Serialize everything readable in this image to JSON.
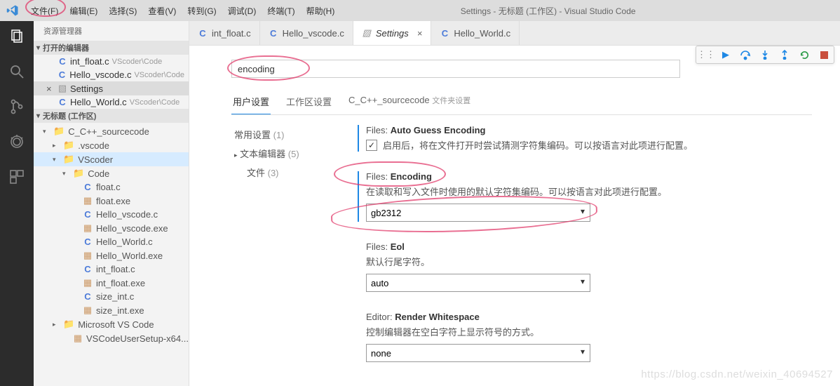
{
  "titlebar": {
    "menus": [
      "文件(F)",
      "编辑(E)",
      "选择(S)",
      "查看(V)",
      "转到(G)",
      "调试(D)",
      "终端(T)",
      "帮助(H)"
    ],
    "title": "Settings - 无标题 (工作区) - Visual Studio Code"
  },
  "sidebar": {
    "title": "资源管理器",
    "openEditorsHeader": "打开的编辑器",
    "openEditors": [
      {
        "icon": "C",
        "name": "int_float.c",
        "path": "VScoder\\Code",
        "active": false
      },
      {
        "icon": "C",
        "name": "Hello_vscode.c",
        "path": "VScoder\\Code",
        "active": false
      },
      {
        "icon": "S",
        "name": "Settings",
        "path": "",
        "active": true
      },
      {
        "icon": "C",
        "name": "Hello_World.c",
        "path": "VScoder\\Code",
        "active": false
      }
    ],
    "workspaceHeader": "无标题 (工作区)",
    "tree": [
      {
        "depth": 0,
        "chev": "▾",
        "type": "folder",
        "name": "C_C++_sourcecode"
      },
      {
        "depth": 1,
        "chev": "▸",
        "type": "folder-blue",
        "name": ".vscode"
      },
      {
        "depth": 1,
        "chev": "▾",
        "type": "folder",
        "name": "VScoder",
        "sel": true
      },
      {
        "depth": 2,
        "chev": "▾",
        "type": "folder",
        "name": "Code"
      },
      {
        "depth": 3,
        "chev": "",
        "type": "c",
        "name": "float.c"
      },
      {
        "depth": 3,
        "chev": "",
        "type": "exe",
        "name": "float.exe"
      },
      {
        "depth": 3,
        "chev": "",
        "type": "c",
        "name": "Hello_vscode.c"
      },
      {
        "depth": 3,
        "chev": "",
        "type": "exe",
        "name": "Hello_vscode.exe"
      },
      {
        "depth": 3,
        "chev": "",
        "type": "c",
        "name": "Hello_World.c"
      },
      {
        "depth": 3,
        "chev": "",
        "type": "exe",
        "name": "Hello_World.exe"
      },
      {
        "depth": 3,
        "chev": "",
        "type": "c",
        "name": "int_float.c"
      },
      {
        "depth": 3,
        "chev": "",
        "type": "exe",
        "name": "int_float.exe"
      },
      {
        "depth": 3,
        "chev": "",
        "type": "c",
        "name": "size_int.c"
      },
      {
        "depth": 3,
        "chev": "",
        "type": "exe",
        "name": "size_int.exe"
      },
      {
        "depth": 1,
        "chev": "▸",
        "type": "folder",
        "name": "Microsoft VS Code"
      },
      {
        "depth": 2,
        "chev": "",
        "type": "exe",
        "name": "VSCodeUserSetup-x64..."
      }
    ]
  },
  "tabs": [
    {
      "icon": "C",
      "label": "int_float.c",
      "active": false
    },
    {
      "icon": "C",
      "label": "Hello_vscode.c",
      "active": false
    },
    {
      "icon": "S",
      "label": "Settings",
      "active": true
    },
    {
      "icon": "C",
      "label": "Hello_World.c",
      "active": false
    }
  ],
  "settings": {
    "search_value": "encoding",
    "scopes": {
      "user": "用户设置",
      "workspace": "工作区设置",
      "folder": "C_C++_sourcecode",
      "folder_sub": "文件夹设置"
    },
    "nav": [
      {
        "label": "常用设置",
        "count": "(1)",
        "indent": 0
      },
      {
        "label": "文本编辑器",
        "count": "(5)",
        "indent": 0,
        "chev": "▸"
      },
      {
        "label": "文件",
        "count": "(3)",
        "indent": 1
      }
    ],
    "items": {
      "autoGuess": {
        "prefix": "Files:",
        "name": "Auto Guess Encoding",
        "desc": "启用后，将在文件打开时尝试猜测字符集编码。可以按语言对此项进行配置。",
        "checked": true
      },
      "encoding": {
        "prefix": "Files:",
        "name": "Encoding",
        "desc": "在读取和写入文件时使用的默认字符集编码。可以按语言对此项进行配置。",
        "value": "gb2312"
      },
      "eol": {
        "prefix": "Files:",
        "name": "Eol",
        "desc": "默认行尾字符。",
        "value": "auto"
      },
      "renderWs": {
        "prefix": "Editor:",
        "name": "Render Whitespace",
        "desc": "控制编辑器在空白字符上显示符号的方式。",
        "value": "none"
      }
    }
  },
  "watermark": "https://blog.csdn.net/weixin_40694527"
}
